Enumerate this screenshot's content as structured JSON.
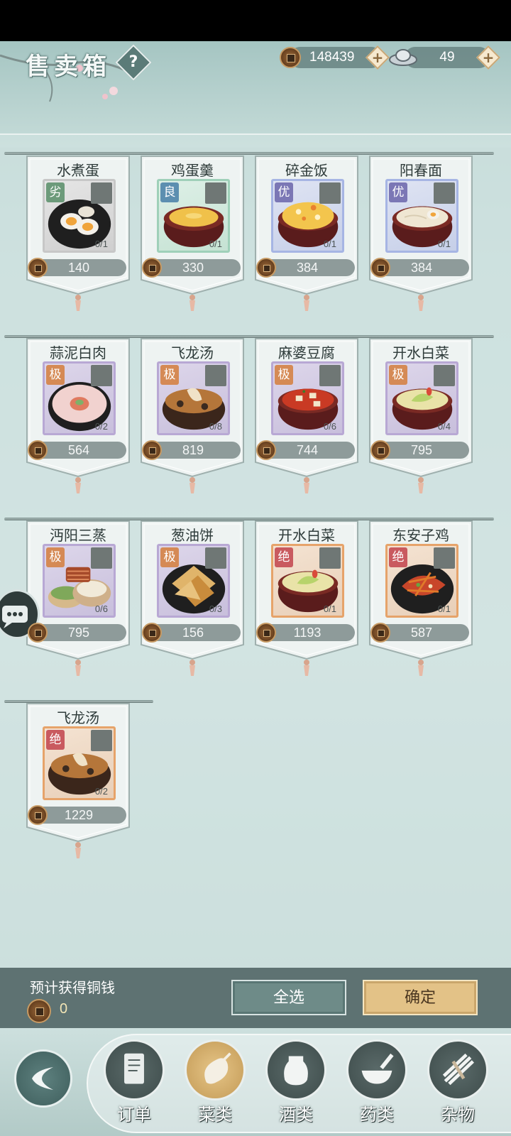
{
  "header": {
    "title": "售卖箱",
    "help_label": "?",
    "copper": "148439",
    "silver": "49",
    "plus": "+"
  },
  "cards": [
    {
      "name": "水煮蛋",
      "grade": "劣",
      "count": "0/1",
      "price": "140",
      "food": "egg",
      "grade_color": "#6c9a7a",
      "frame": "plain"
    },
    {
      "name": "鸡蛋羹",
      "grade": "良",
      "count": "0/1",
      "price": "330",
      "food": "custard",
      "grade_color": "#5c8fb0",
      "frame": "good"
    },
    {
      "name": "碎金饭",
      "grade": "优",
      "count": "0/1",
      "price": "384",
      "food": "rice",
      "grade_color": "#7b77b5",
      "frame": "excellent"
    },
    {
      "name": "阳春面",
      "grade": "优",
      "count": "0/1",
      "price": "384",
      "food": "noodle",
      "grade_color": "#7b77b5",
      "frame": "excellent"
    },
    {
      "name": "蒜泥白肉",
      "grade": "极",
      "count": "0/2",
      "price": "564",
      "food": "pork",
      "grade_color": "#d58a55",
      "frame": "supreme"
    },
    {
      "name": "飞龙汤",
      "grade": "极",
      "count": "0/8",
      "price": "819",
      "food": "soup",
      "grade_color": "#d58a55",
      "frame": "supreme"
    },
    {
      "name": "麻婆豆腐",
      "grade": "极",
      "count": "0/6",
      "price": "744",
      "food": "tofu",
      "grade_color": "#d58a55",
      "frame": "supreme"
    },
    {
      "name": "开水白菜",
      "grade": "极",
      "count": "0/4",
      "price": "795",
      "food": "cabbage",
      "grade_color": "#d58a55",
      "frame": "supreme"
    },
    {
      "name": "沔阳三蒸",
      "grade": "极",
      "count": "0/6",
      "price": "795",
      "food": "steam",
      "grade_color": "#d58a55",
      "frame": "supreme"
    },
    {
      "name": "葱油饼",
      "grade": "极",
      "count": "0/3",
      "price": "156",
      "food": "pancake",
      "grade_color": "#d58a55",
      "frame": "supreme"
    },
    {
      "name": "开水白菜",
      "grade": "绝",
      "count": "0/1",
      "price": "1193",
      "food": "cabbage",
      "grade_color": "#c95a5f",
      "frame": "legend"
    },
    {
      "name": "东安子鸡",
      "grade": "绝",
      "count": "0/1",
      "price": "587",
      "food": "chicken",
      "grade_color": "#c95a5f",
      "frame": "legend"
    },
    {
      "name": "飞龙汤",
      "grade": "绝",
      "count": "0/2",
      "price": "1229",
      "food": "soup",
      "grade_color": "#c95a5f",
      "frame": "legend"
    }
  ],
  "footer": {
    "estimate_label": "预计获得铜钱",
    "estimate_value": "0",
    "select_all": "全选",
    "confirm": "确定"
  },
  "nav": [
    {
      "label": "订单",
      "icon": "scroll-icon",
      "active": false
    },
    {
      "label": "菜类",
      "icon": "eggplant-icon",
      "active": true
    },
    {
      "label": "酒类",
      "icon": "wine-jar-icon",
      "active": false
    },
    {
      "label": "药类",
      "icon": "mortar-icon",
      "active": false
    },
    {
      "label": "杂物",
      "icon": "bundle-icon",
      "active": false
    }
  ]
}
